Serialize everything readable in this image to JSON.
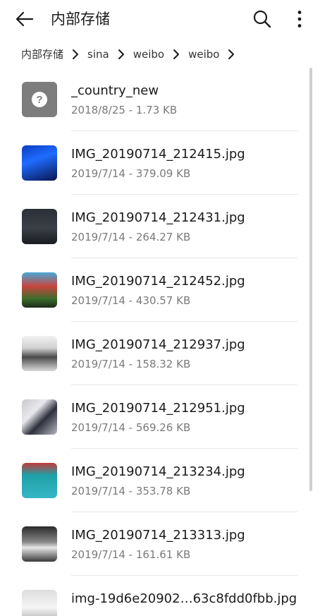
{
  "header": {
    "title": "内部存储"
  },
  "breadcrumb": [
    "内部存储",
    "sina",
    "weibo",
    "weibo"
  ],
  "files": [
    {
      "name": "_country_new",
      "meta": "2018/8/25 - 1.73 KB",
      "thumb": "unknown-file-icon"
    },
    {
      "name": "IMG_20190714_212415.jpg",
      "meta": "2019/7/14 - 379.09 KB",
      "thumb": "image-thumbnail"
    },
    {
      "name": "IMG_20190714_212431.jpg",
      "meta": "2019/7/14 - 264.27 KB",
      "thumb": "image-thumbnail"
    },
    {
      "name": "IMG_20190714_212452.jpg",
      "meta": "2019/7/14 - 430.57 KB",
      "thumb": "image-thumbnail"
    },
    {
      "name": "IMG_20190714_212937.jpg",
      "meta": "2019/7/14 - 158.32 KB",
      "thumb": "image-thumbnail"
    },
    {
      "name": "IMG_20190714_212951.jpg",
      "meta": "2019/7/14 - 569.26 KB",
      "thumb": "image-thumbnail"
    },
    {
      "name": "IMG_20190714_213234.jpg",
      "meta": "2019/7/14 - 353.78 KB",
      "thumb": "image-thumbnail"
    },
    {
      "name": "IMG_20190714_213313.jpg",
      "meta": "2019/7/14 - 161.61 KB",
      "thumb": "image-thumbnail"
    },
    {
      "name": "img-19d6e20902…63c8fdd0fbb.jpg",
      "meta": "",
      "thumb": "image-thumbnail"
    }
  ],
  "icons": {
    "back": "back-arrow-icon",
    "search": "search-icon",
    "more": "more-vertical-icon",
    "separator": "chevron-right-icon"
  },
  "colors": {
    "text_primary": "#1b1b1b",
    "text_secondary": "#7a7a7a",
    "divider": "#e6e6e6"
  }
}
